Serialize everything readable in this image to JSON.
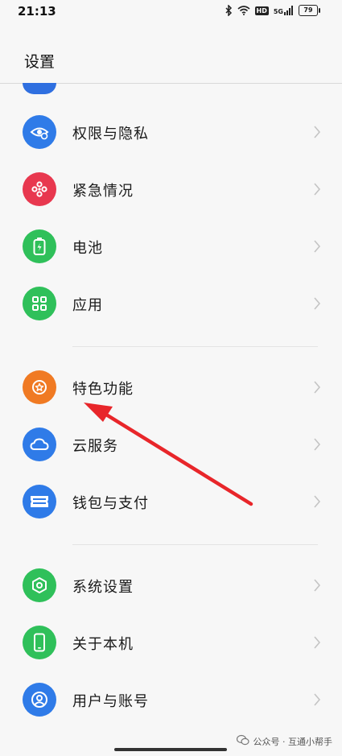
{
  "status_bar": {
    "time": "21:13",
    "network": "5G",
    "hd": "HD",
    "battery": "79"
  },
  "header": {
    "title": "设置"
  },
  "settings_items": [
    {
      "label": "权限与隐私",
      "icon": "privacy-eye-icon",
      "color": "#2f7be8"
    },
    {
      "label": "紧急情况",
      "icon": "emergency-icon",
      "color": "#e8384f"
    },
    {
      "label": "电池",
      "icon": "battery-icon",
      "color": "#2fc05a"
    },
    {
      "label": "应用",
      "icon": "apps-grid-icon",
      "color": "#2fc05a"
    },
    {
      "label": "特色功能",
      "icon": "star-badge-icon",
      "color": "#f07a23"
    },
    {
      "label": "云服务",
      "icon": "cloud-icon",
      "color": "#2f7be8"
    },
    {
      "label": "钱包与支付",
      "icon": "wallet-icon",
      "color": "#2f7be8"
    },
    {
      "label": "系统设置",
      "icon": "system-hexagon-icon",
      "color": "#2fc05a"
    },
    {
      "label": "关于本机",
      "icon": "phone-icon",
      "color": "#2fc05a"
    },
    {
      "label": "用户与账号",
      "icon": "user-account-icon",
      "color": "#2f7be8"
    }
  ],
  "annotation": {
    "arrow_color": "#e8262a"
  },
  "watermark": {
    "text": "公众号 · 互通小帮手"
  }
}
